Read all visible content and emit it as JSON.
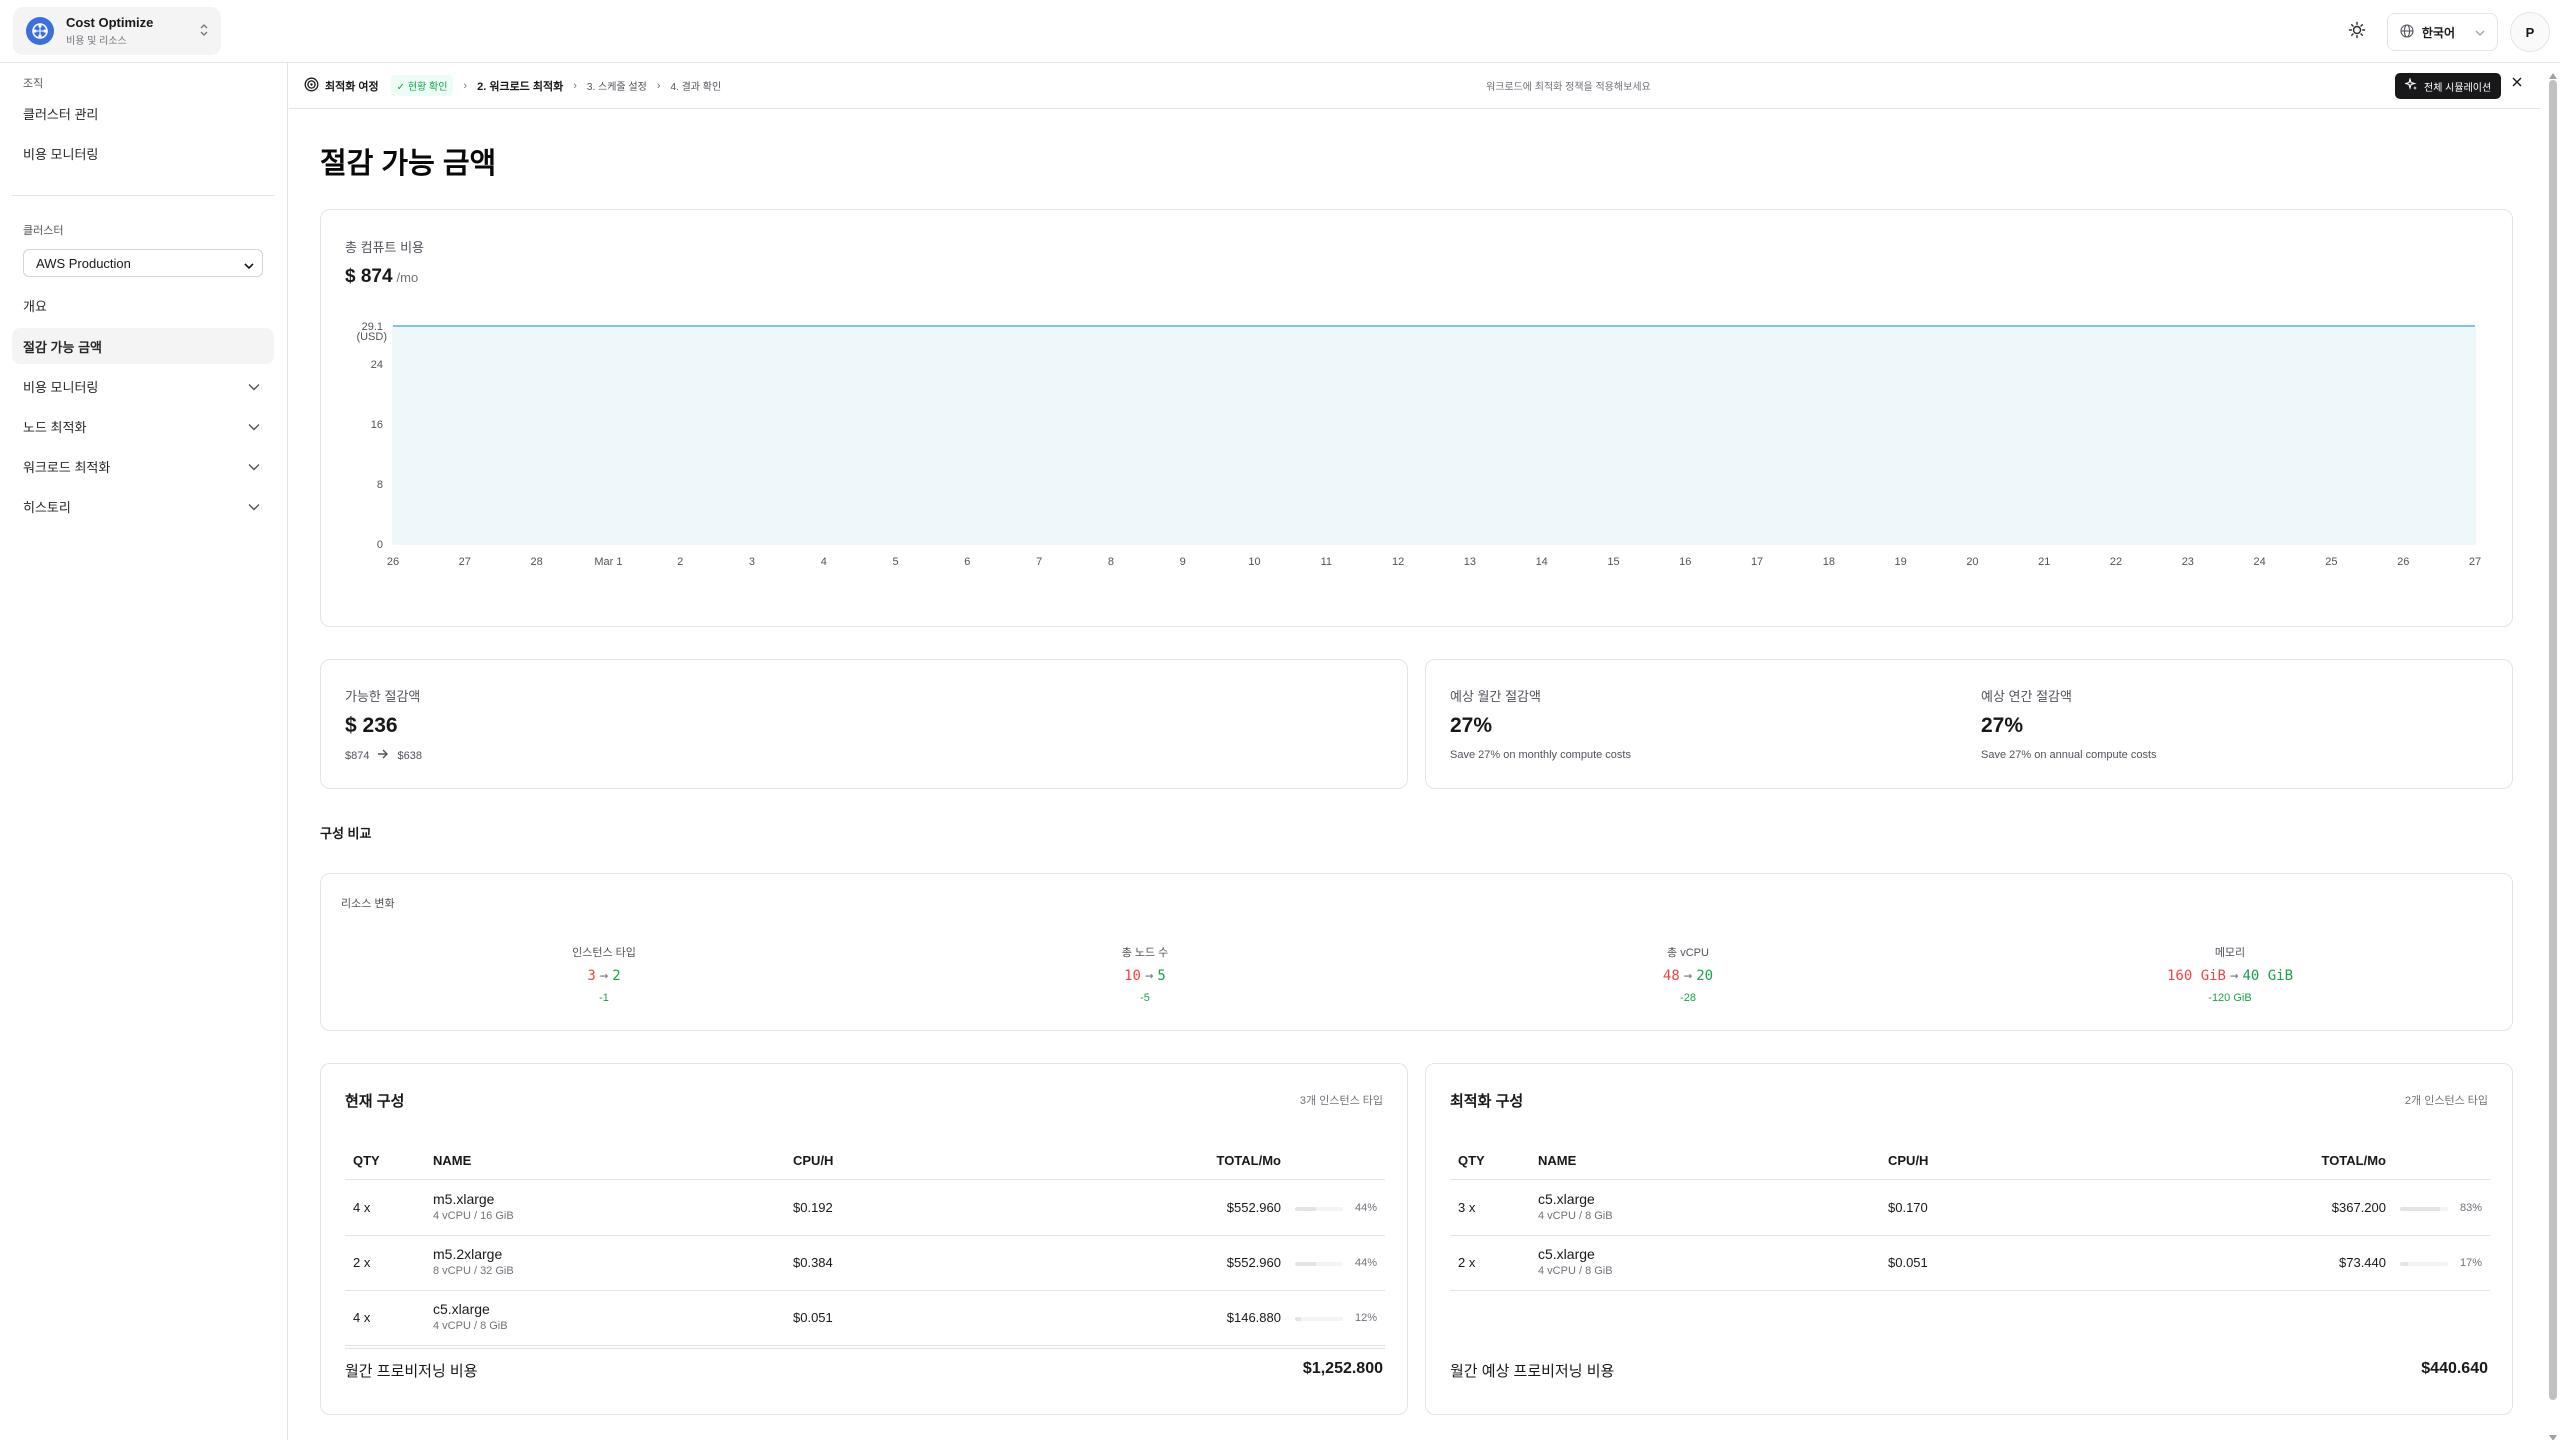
{
  "app": {
    "name": "Cost Optimize",
    "subtitle": "비용 및 리소스",
    "language": "한국어",
    "avatar_initial": "P"
  },
  "sidebar": {
    "org_section": "조직",
    "org_items": [
      {
        "label": "클러스터 관리"
      },
      {
        "label": "비용 모니터링"
      }
    ],
    "cluster_section": "클러스터",
    "cluster_select": "AWS Production",
    "nav_items": [
      {
        "label": "개요",
        "active": false,
        "expandable": false
      },
      {
        "label": "절감 가능 금액",
        "active": true,
        "expandable": false
      },
      {
        "label": "비용 모니터링",
        "active": false,
        "expandable": true
      },
      {
        "label": "노드 최적화",
        "active": false,
        "expandable": true
      },
      {
        "label": "워크로드 최적화",
        "active": false,
        "expandable": true
      },
      {
        "label": "히스토리",
        "active": false,
        "expandable": true
      }
    ]
  },
  "journey": {
    "title": "최적화 여정",
    "step1": "현황 확인",
    "step2": "2. 워크로드 최적화",
    "step3": "3. 스케줄 설정",
    "step4": "4. 결과 확인",
    "hint": "워크로드에 최적화 정책을 적용해보세요",
    "sim_button": "전체 시뮬레이션"
  },
  "page": {
    "title": "절감 가능 금액"
  },
  "compute_cost": {
    "label": "총 컴퓨트 비용",
    "value": "$ 874",
    "unit": "/mo"
  },
  "chart_data": {
    "type": "area",
    "title": "",
    "xlabel": "",
    "ylabel": "(USD)",
    "ylim": [
      0,
      29.1
    ],
    "yticks": [
      "0",
      "8",
      "16",
      "24",
      "29.1"
    ],
    "x": [
      "26",
      "27",
      "28",
      "Mar 1",
      "2",
      "3",
      "4",
      "5",
      "6",
      "7",
      "8",
      "9",
      "10",
      "11",
      "12",
      "13",
      "14",
      "15",
      "16",
      "17",
      "18",
      "19",
      "20",
      "21",
      "22",
      "23",
      "24",
      "25",
      "26",
      "27"
    ],
    "series": [
      {
        "values": [
          29.1,
          29.1,
          29.1,
          29.1,
          29.1,
          29.1,
          29.1,
          29.1,
          29.1,
          29.1,
          29.1,
          29.1,
          29.1,
          29.1,
          29.1,
          29.1,
          29.1,
          29.1,
          29.1,
          29.1,
          29.1,
          29.1,
          29.1,
          29.1,
          29.1,
          29.1,
          29.1,
          29.1,
          29.1,
          29.1
        ]
      }
    ],
    "grid": true,
    "colors": {
      "line": "#7cc4e0",
      "fill": "#eef8fb",
      "grid": "#eeeeee"
    }
  },
  "savings": {
    "label": "가능한 절감액",
    "value": "$ 236",
    "from": "$874",
    "to": "$638"
  },
  "monthly": {
    "label": "예상 월간 절감액",
    "value": "27%",
    "note": "Save 27% on monthly compute costs"
  },
  "annual": {
    "label": "예상 연간 절감액",
    "value": "27%",
    "note": "Save 27% on annual compute costs"
  },
  "comparison": {
    "section_title": "구성 비교",
    "card_title": "리소스 변화",
    "items": [
      {
        "title": "인스턴스 타입",
        "old": "3",
        "new": "2",
        "delta": "-1"
      },
      {
        "title": "총 노드 수",
        "old": "10",
        "new": "5",
        "delta": "-5"
      },
      {
        "title": "총 vCPU",
        "old": "48",
        "new": "20",
        "delta": "-28"
      },
      {
        "title": "메모리",
        "old": "160 GiB",
        "new": "40 GiB",
        "delta": "-120 GiB"
      }
    ]
  },
  "current_config": {
    "title": "현재 구성",
    "count": "3개 인스턴스 타입",
    "headers": {
      "qty": "QTY",
      "name": "NAME",
      "cpu": "CPU/H",
      "total": "TOTAL/Mo"
    },
    "rows": [
      {
        "qty": "4 x",
        "name": "m5.xlarge",
        "spec": "4 vCPU / 16 GiB",
        "cpu": "$0.192",
        "total": "$552.960",
        "pct": "44%",
        "share": 0.44
      },
      {
        "qty": "2 x",
        "name": "m5.2xlarge",
        "spec": "8 vCPU / 32 GiB",
        "cpu": "$0.384",
        "total": "$552.960",
        "pct": "44%",
        "share": 0.44
      },
      {
        "qty": "4 x",
        "name": "c5.xlarge",
        "spec": "4 vCPU / 8 GiB",
        "cpu": "$0.051",
        "total": "$146.880",
        "pct": "12%",
        "share": 0.12
      }
    ],
    "footer_label": "월간 프로비저닝 비용",
    "footer_value": "$1,252.800"
  },
  "optimized_config": {
    "title": "최적화 구성",
    "count": "2개 인스턴스 타입",
    "headers": {
      "qty": "QTY",
      "name": "NAME",
      "cpu": "CPU/H",
      "total": "TOTAL/Mo"
    },
    "rows": [
      {
        "qty": "3 x",
        "name": "c5.xlarge",
        "spec": "4 vCPU / 8 GiB",
        "cpu": "$0.170",
        "total": "$367.200",
        "pct": "83%",
        "share": 0.83
      },
      {
        "qty": "2 x",
        "name": "c5.xlarge",
        "spec": "4 vCPU / 8 GiB",
        "cpu": "$0.051",
        "total": "$73.440",
        "pct": "17%",
        "share": 0.17
      }
    ],
    "footer_label": "월간 예상 프로비저닝 비용",
    "footer_value": "$440.640"
  }
}
